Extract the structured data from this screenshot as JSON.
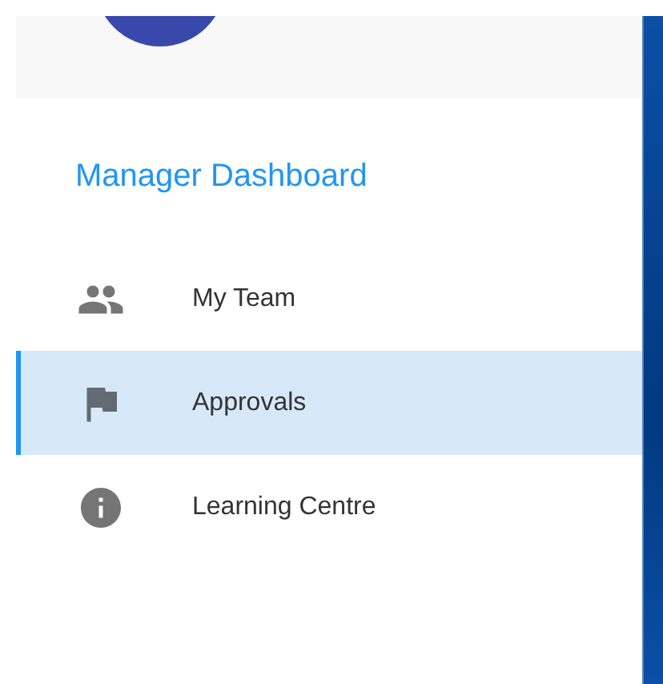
{
  "sidebar": {
    "title": "Manager Dashboard",
    "items": [
      {
        "label": "My Team",
        "kind": "team",
        "selected": false
      },
      {
        "label": "Approvals",
        "kind": "flag",
        "selected": true
      },
      {
        "label": "Learning Centre",
        "kind": "info",
        "selected": false
      }
    ]
  }
}
